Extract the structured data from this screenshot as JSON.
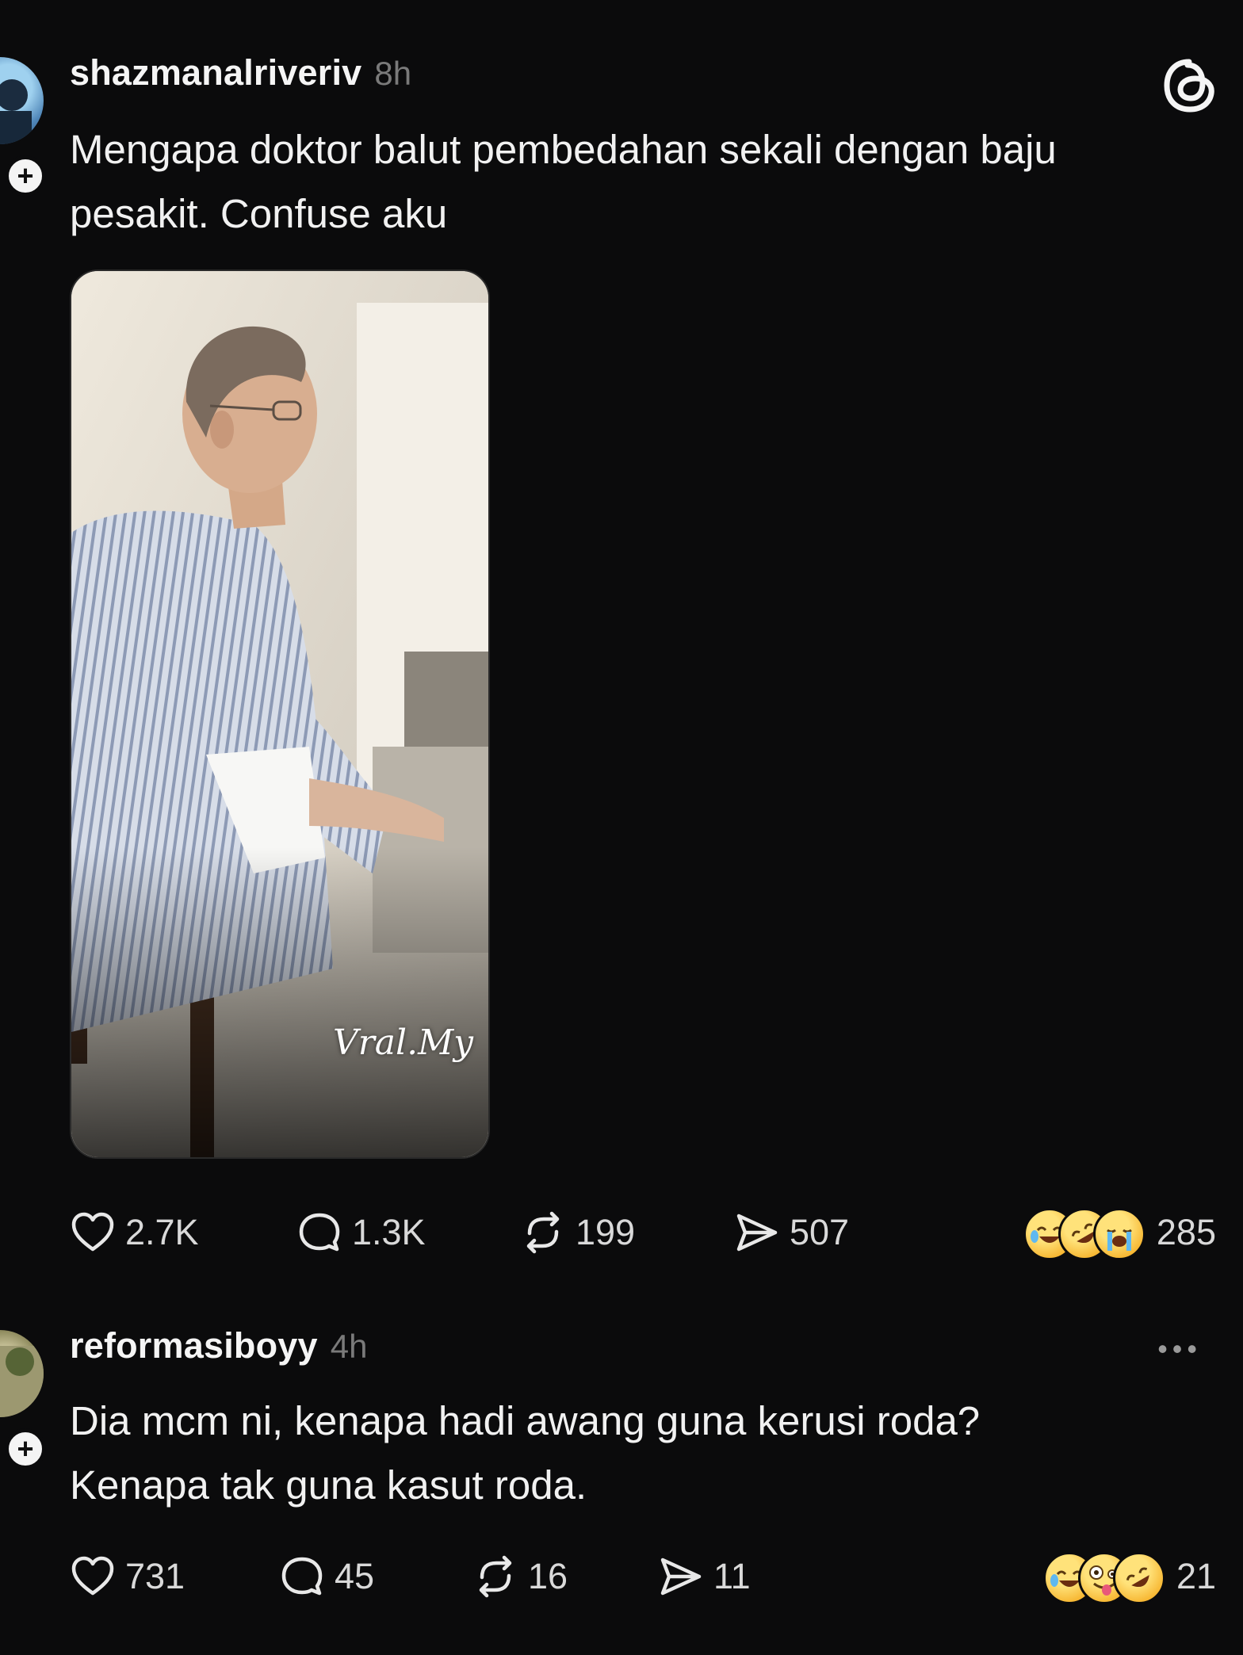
{
  "colors": {
    "background": "#0b0b0c",
    "text_primary": "#f1f1f1",
    "text_muted": "#7a7a7a"
  },
  "post": {
    "username": "shazmanalriveriv",
    "time": "8h",
    "text": "Mengapa doktor balut pembedahan sekali dengan baju\npesakit. Confuse aku",
    "media_watermark": "Vral.My",
    "stats": {
      "likes": "2.7K",
      "replies": "1.3K",
      "reposts": "199",
      "shares": "507",
      "reactions": "285"
    },
    "reaction_emojis": [
      "tears-of-joy-emoji",
      "rofl-emoji",
      "loudly-crying-emoji"
    ]
  },
  "reply": {
    "username": "reformasiboyy",
    "time": "4h",
    "text": "Dia mcm ni, kenapa hadi awang guna kerusi roda?\nKenapa tak guna kasut roda.",
    "stats": {
      "likes": "731",
      "replies": "45",
      "reposts": "16",
      "shares": "11",
      "reactions": "21"
    },
    "reaction_emojis": [
      "tears-of-joy-emoji",
      "zany-face-emoji",
      "rofl-emoji"
    ]
  }
}
